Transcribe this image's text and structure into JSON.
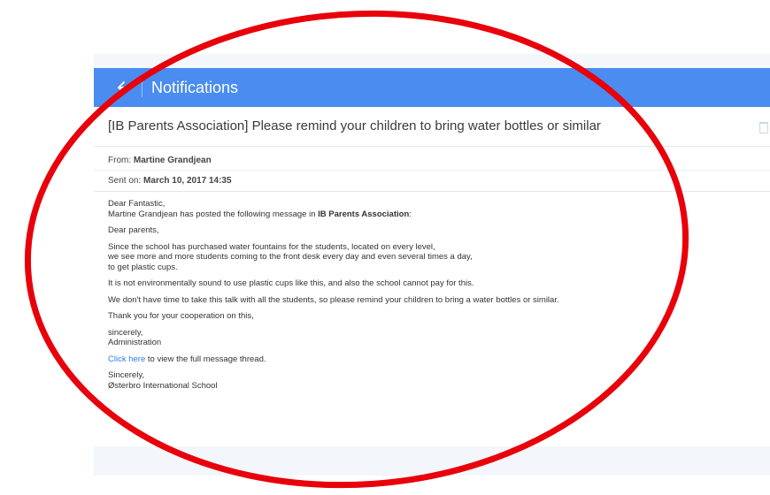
{
  "header": {
    "title": "Notifications",
    "back_icon": "arrow-left-icon"
  },
  "message": {
    "subject": "[IB Parents Association] Please remind your children to bring water bottles or similar",
    "from_label": "From:",
    "from_value": "Martine Grandjean",
    "sent_label": "Sent on:",
    "sent_value": "March 10, 2017 14:35",
    "greeting": "Dear Fantastic,",
    "intro_pre": "Martine Grandjean has posted the following message in ",
    "intro_group": "IB Parents Association",
    "intro_post": ":",
    "salutation": "Dear parents,",
    "para1_line1": "Since the school has purchased water fountains for the students, located on every level,",
    "para1_line2": "we see more and more students coming to the front desk every day and even several times a day,",
    "para1_line3": "to get plastic cups.",
    "para2": "It is not environmentally sound to use plastic cups like this, and also the school cannot pay for this.",
    "para3": "We don't have time to take this talk with all the students, so please remind your children to bring a water bottles or similar.",
    "para4": "Thank you for your cooperation on this,",
    "closing1_line1": "sincerely,",
    "closing1_line2": "Administration",
    "link_text": "Click here",
    "link_suffix": " to view the full message thread.",
    "closing2_line1": "Sincerely,",
    "closing2_line2": "Østerbro International School"
  },
  "colors": {
    "header_bg": "#4a8cf0",
    "annotation": "#e8000b",
    "link": "#2e7ce6"
  }
}
